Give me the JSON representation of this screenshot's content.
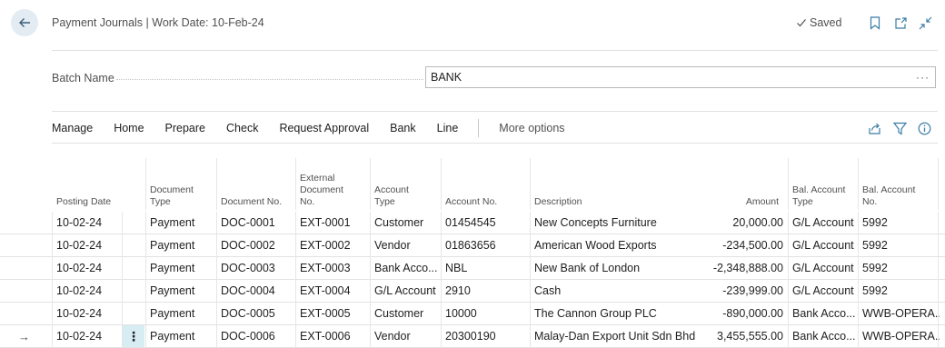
{
  "header": {
    "title": "Payment Journals | Work Date: 10-Feb-24",
    "saved_label": "Saved"
  },
  "batch": {
    "label": "Batch Name",
    "value": "BANK",
    "more": "···"
  },
  "toolbar": {
    "items": [
      "Manage",
      "Home",
      "Prepare",
      "Check",
      "Request Approval",
      "Bank",
      "Line"
    ],
    "more_options": "More options"
  },
  "table": {
    "columns": [
      [
        "Posting Date"
      ],
      [
        "Document",
        "Type"
      ],
      [
        "Document No."
      ],
      [
        "External",
        "Document",
        "No."
      ],
      [
        "Account",
        "Type"
      ],
      [
        "Account No."
      ],
      [
        "Description"
      ],
      [
        "Amount"
      ],
      [
        "Bal. Account",
        "Type"
      ],
      [
        "Bal. Account",
        "No."
      ]
    ],
    "rows": [
      [
        "10-02-24",
        "Payment",
        "DOC-0001",
        "EXT-0001",
        "Customer",
        "01454545",
        "New Concepts Furniture",
        "20,000.00",
        "G/L Account",
        "5992"
      ],
      [
        "10-02-24",
        "Payment",
        "DOC-0002",
        "EXT-0002",
        "Vendor",
        "01863656",
        "American Wood Exports",
        "-234,500.00",
        "G/L Account",
        "5992"
      ],
      [
        "10-02-24",
        "Payment",
        "DOC-0003",
        "EXT-0003",
        "Bank Acco...",
        "NBL",
        "New Bank of London",
        "-2,348,888.00",
        "G/L Account",
        "5992"
      ],
      [
        "10-02-24",
        "Payment",
        "DOC-0004",
        "EXT-0004",
        "G/L Account",
        "2910",
        "Cash",
        "-239,999.00",
        "G/L Account",
        "5992"
      ],
      [
        "10-02-24",
        "Payment",
        "DOC-0005",
        "EXT-0005",
        "Customer",
        "10000",
        "The Cannon Group PLC",
        "-890,000.00",
        "Bank Acco...",
        "WWB-OPERA..."
      ],
      [
        "10-02-24",
        "Payment",
        "DOC-0006",
        "EXT-0006",
        "Vendor",
        "20300190",
        "Malay-Dan Export Unit Sdn Bhd",
        "3,455,555.00",
        "Bank Acco...",
        "WWB-OPERA..."
      ]
    ],
    "current_row_marker": "→",
    "active_cell_glyph": "⋮"
  },
  "colors": {
    "accent": "#3a7ca5",
    "back_button_bg": "#e3ecf2",
    "active_cell_bg": "#d8ecf3"
  },
  "icons": [
    "back-arrow-icon",
    "checkmark-icon",
    "bookmark-icon",
    "open-new-window-icon",
    "collapse-icon",
    "share-icon",
    "filter-icon",
    "info-icon",
    "row-actions-icon"
  ]
}
